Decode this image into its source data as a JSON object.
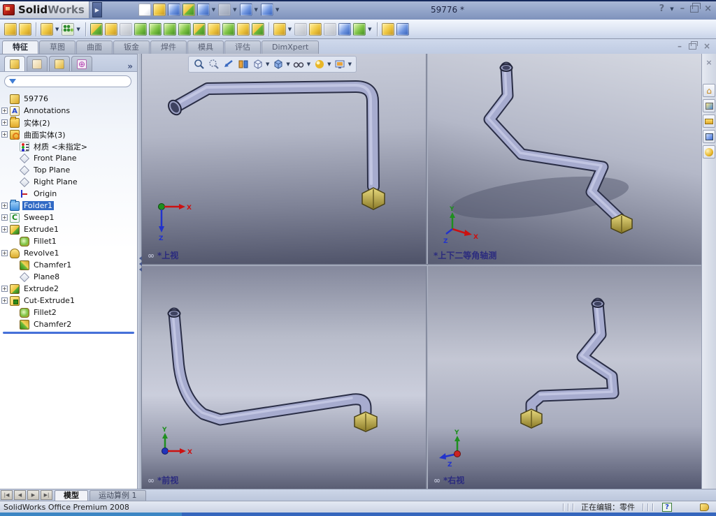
{
  "window": {
    "brand_bold": "Solid",
    "brand_light": "Works",
    "doc_title": "59776 *",
    "controls": {
      "help": "?",
      "minimize": "–",
      "close": "×"
    }
  },
  "standard_toolbar": [
    "new-document",
    "open-document",
    "make-drawing-from-part",
    "make-assembly-from-part",
    "save",
    "print",
    "undo",
    "options"
  ],
  "features_toolbar": [
    "hole-wizard",
    "simple-hole",
    "fillet-flyout",
    "pattern-flyout",
    "extruded-boss",
    "extruded-cut",
    "swept-boss",
    "revolved-boss",
    "revolved-cut",
    "lofted-boss",
    "shell",
    "draft",
    "rib",
    "dome",
    "deform",
    "flex",
    "freeform-flyout",
    "mirror",
    "linear-pattern",
    "circular-pattern",
    "curves",
    "spline-flyout",
    "reference-geometry",
    "move-copy-bodies"
  ],
  "headsup_toolbar": [
    "zoom-to-fit",
    "zoom-to-area",
    "previous-view",
    "section-view",
    "view-orientation",
    "display-style",
    "hide-show-items",
    "edit-appearance",
    "apply-scene"
  ],
  "command_tabs": {
    "items": [
      "特征",
      "草图",
      "曲面",
      "钣金",
      "焊件",
      "模具",
      "评估",
      "DimXpert"
    ],
    "active": "特征"
  },
  "feature_panel": {
    "tabs": [
      "featuremanager-design-tree",
      "propertymanager",
      "configurationmanager",
      "dimxpertmanager"
    ],
    "chevron": "»",
    "dimxpert_glyph": "⊕",
    "expand_glyph": "+"
  },
  "feature_tree": {
    "items": [
      {
        "label": "59776",
        "icon": "part"
      },
      {
        "label": "Annotations",
        "icon": "annotations-folder"
      },
      {
        "label": "实体(2)",
        "icon": "solid-bodies-folder"
      },
      {
        "label": "曲面实体(3)",
        "icon": "surface-bodies-folder"
      },
      {
        "label": "材质 <未指定>",
        "icon": "material"
      },
      {
        "label": "Front Plane",
        "icon": "plane"
      },
      {
        "label": "Top Plane",
        "icon": "plane"
      },
      {
        "label": "Right Plane",
        "icon": "plane"
      },
      {
        "label": "Origin",
        "icon": "origin"
      },
      {
        "label": "Folder1",
        "icon": "folder",
        "selected": true
      },
      {
        "label": "Sweep1",
        "icon": "sweep"
      },
      {
        "label": "Extrude1",
        "icon": "extrude"
      },
      {
        "label": "Fillet1",
        "icon": "fillet"
      },
      {
        "label": "Revolve1",
        "icon": "revolve"
      },
      {
        "label": "Chamfer1",
        "icon": "chamfer"
      },
      {
        "label": "Plane8",
        "icon": "plane"
      },
      {
        "label": "Extrude2",
        "icon": "extrude"
      },
      {
        "label": "Cut-Extrude1",
        "icon": "cut-extrude"
      },
      {
        "label": "Fillet2",
        "icon": "fillet"
      },
      {
        "label": "Chamfer2",
        "icon": "chamfer"
      }
    ]
  },
  "viewports": {
    "top_left": {
      "label": "*上视"
    },
    "top_right": {
      "label": "*上下二等角轴测"
    },
    "bottom_left": {
      "label": "*前视"
    },
    "bottom_right": {
      "label": "*右视"
    },
    "link_glyph": "∞",
    "axis_labels": {
      "x": "X",
      "y": "Y",
      "z": "Z"
    }
  },
  "bottom_tabs": {
    "nav": [
      "|◀",
      "◀",
      "▶",
      "▶|"
    ],
    "model": "模型",
    "motion_study": "运动算例 1"
  },
  "status_bar": {
    "product": "SolidWorks Office Premium 2008",
    "editing": "正在编辑：零件",
    "help_glyph": "?"
  },
  "colors": {
    "selection": "#316ac5",
    "pipe_body": "#a7accf",
    "pipe_outline": "#2a2e46",
    "nut_gold": "#c9b23c",
    "viewport_label": "#2b2b7e"
  }
}
